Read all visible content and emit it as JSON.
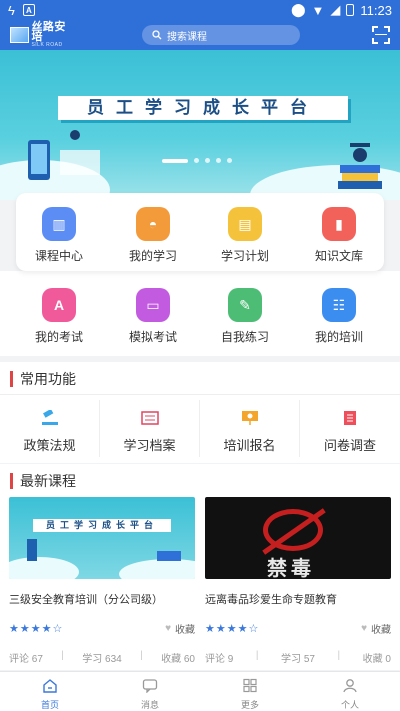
{
  "status": {
    "time": "11:23"
  },
  "header": {
    "logo_text": "丝路安培",
    "logo_sub": "SILK ROAD",
    "search_placeholder": "搜索课程"
  },
  "banner": {
    "title": "员工学习成长平台"
  },
  "grid": {
    "row1": [
      {
        "label": "课程中心",
        "color": "#5b8df5"
      },
      {
        "label": "我的学习",
        "color": "#f39a3a"
      },
      {
        "label": "学习计划",
        "color": "#f5c33b"
      },
      {
        "label": "知识文库",
        "color": "#f2625a"
      }
    ],
    "row2": [
      {
        "label": "我的考试",
        "color": "#f05a9a"
      },
      {
        "label": "模拟考试",
        "color": "#c25be0"
      },
      {
        "label": "自我练习",
        "color": "#4dbd76"
      },
      {
        "label": "我的培训",
        "color": "#3c8df0"
      }
    ]
  },
  "common": {
    "title": "常用功能",
    "items": [
      {
        "label": "政策法规"
      },
      {
        "label": "学习档案"
      },
      {
        "label": "培训报名"
      },
      {
        "label": "问卷调查"
      }
    ]
  },
  "latest": {
    "title": "最新课程",
    "courses": [
      {
        "name": "三级安全教育培训（分公司级）",
        "thumb_title": "员工学习成长平台",
        "rating": 4.5,
        "fav_label": "收藏",
        "comments": "评论 67",
        "studies": "学习 634",
        "favorites": "收藏 60"
      },
      {
        "name": "远离毒品珍爱生命专题教育",
        "thumb_title": "禁毒",
        "rating": 4.5,
        "fav_label": "收藏",
        "comments": "评论 9",
        "studies": "学习 57",
        "favorites": "收藏 0"
      }
    ]
  },
  "nav": [
    {
      "label": "首页",
      "active": true
    },
    {
      "label": "消息",
      "active": false
    },
    {
      "label": "更多",
      "active": false
    },
    {
      "label": "个人",
      "active": false
    }
  ]
}
